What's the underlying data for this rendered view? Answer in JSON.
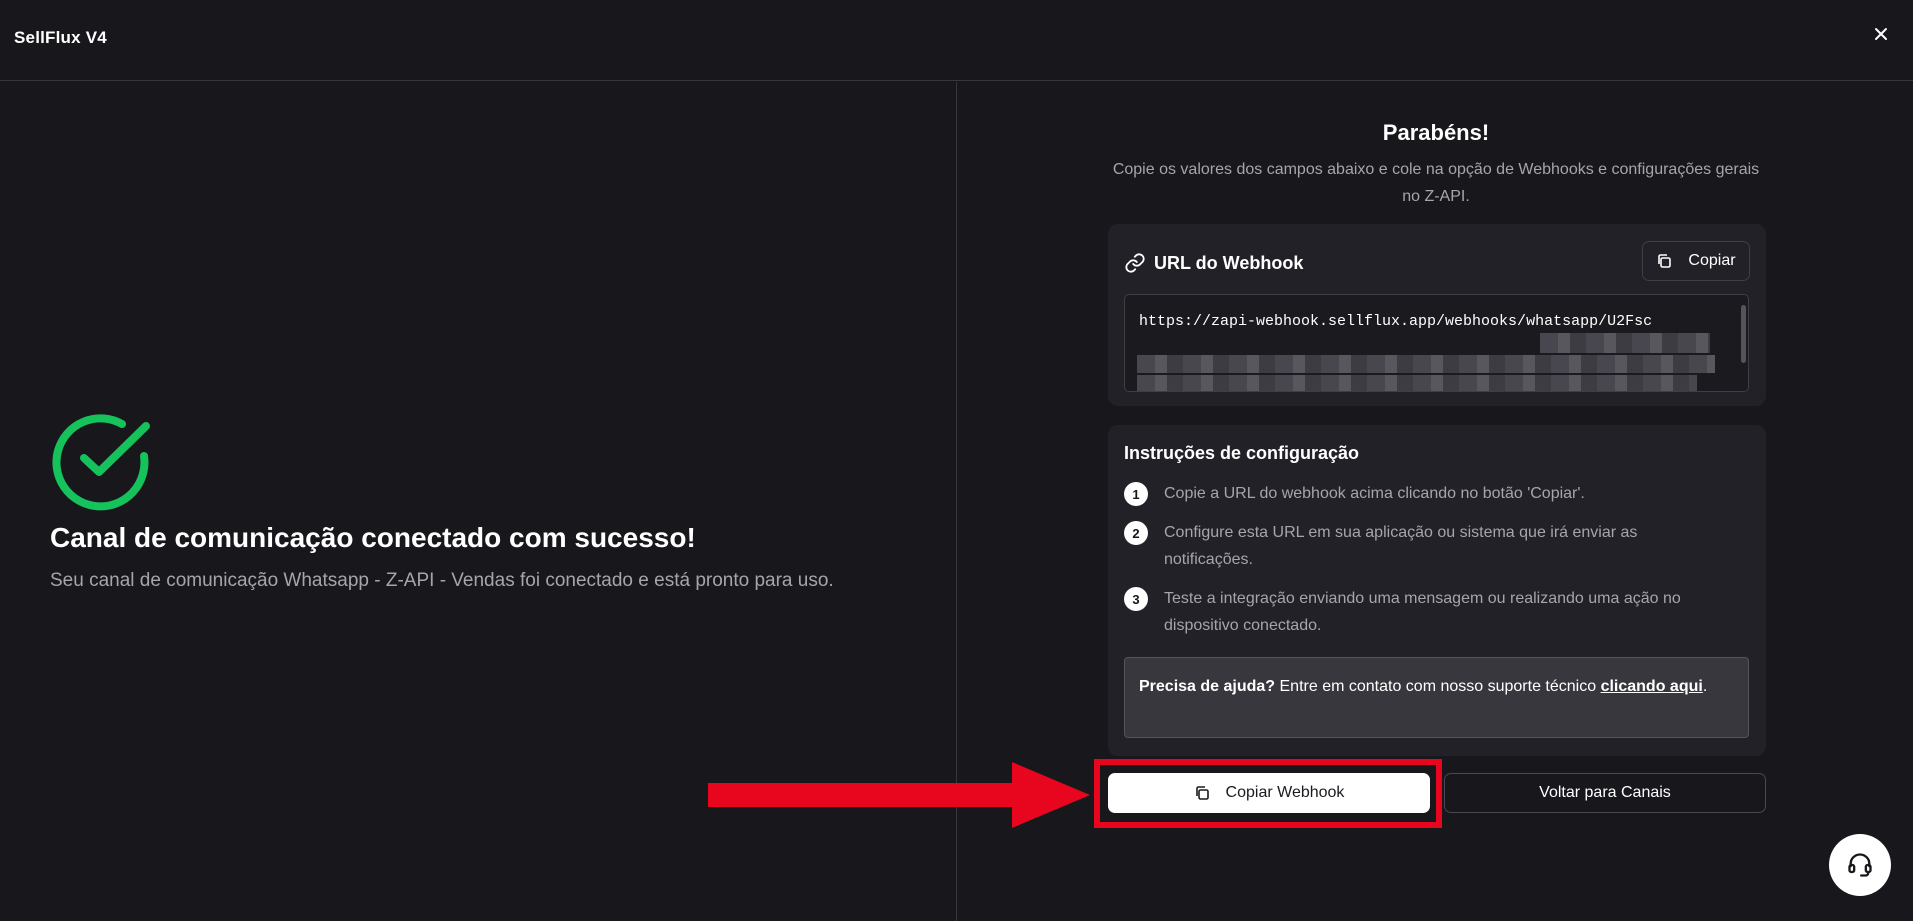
{
  "header": {
    "app_title": "SellFlux V4",
    "close_icon": "close-icon"
  },
  "left": {
    "status_icon": "check-circle-icon",
    "title": "Canal de comunicação conectado com sucesso!",
    "description": "Seu canal de comunicação Whatsapp - Z-API - Vendas foi conectado e está pronto para uso."
  },
  "right": {
    "title": "Parabéns!",
    "description": "Copie os valores dos campos abaixo e cole na opção de Webhooks e configurações gerais no Z-API.",
    "webhook": {
      "icon": "link-icon",
      "label": "URL do Webhook",
      "copy_label": "Copiar",
      "url": "https://zapi-webhook.sellflux.app/webhooks/whatsapp/U2Fsc"
    },
    "instructions": {
      "title": "Instruções de configuração",
      "steps": [
        {
          "num": "1",
          "text": "Copie a URL do webhook acima clicando no botão 'Copiar'."
        },
        {
          "num": "2",
          "text": "Configure esta URL em sua aplicação ou sistema que irá enviar as notificações."
        },
        {
          "num": "3",
          "text": "Teste a integração enviando uma mensagem ou realizando uma ação no dispositivo conectado."
        }
      ],
      "help_bold": "Precisa de ajuda?",
      "help_text": " Entre em contato com nosso suporte técnico ",
      "help_link": "clicando aqui",
      "help_end": "."
    },
    "actions": {
      "copy_webhook": "Copiar Webhook",
      "back": "Voltar para Canais"
    }
  },
  "support_icon": "headset-icon",
  "colors": {
    "background": "#18171c",
    "card": "#222127",
    "success": "#16c25b",
    "highlight": "#e8061f"
  }
}
